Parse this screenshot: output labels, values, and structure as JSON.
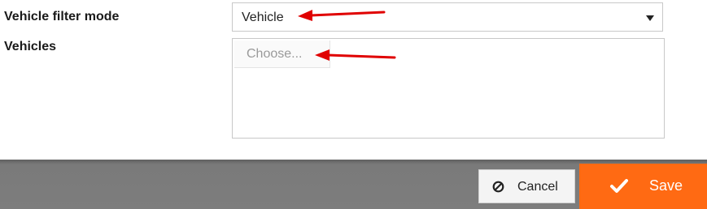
{
  "form": {
    "filter_mode_label": "Vehicle filter mode",
    "filter_mode_value": "Vehicle",
    "vehicles_label": "Vehicles",
    "vehicles_placeholder": "Choose..."
  },
  "footer": {
    "cancel_label": "Cancel",
    "save_label": "Save"
  },
  "icons": {
    "cancel": "cancel-circle-slash-icon",
    "save": "checkmark-icon",
    "dropdown": "caret-down-icon",
    "annotation": "red-arrow-icon"
  },
  "colors": {
    "save_bg": "#ff6a13",
    "annotation": "#e00000",
    "footer_bg": "#7d7d7d"
  }
}
